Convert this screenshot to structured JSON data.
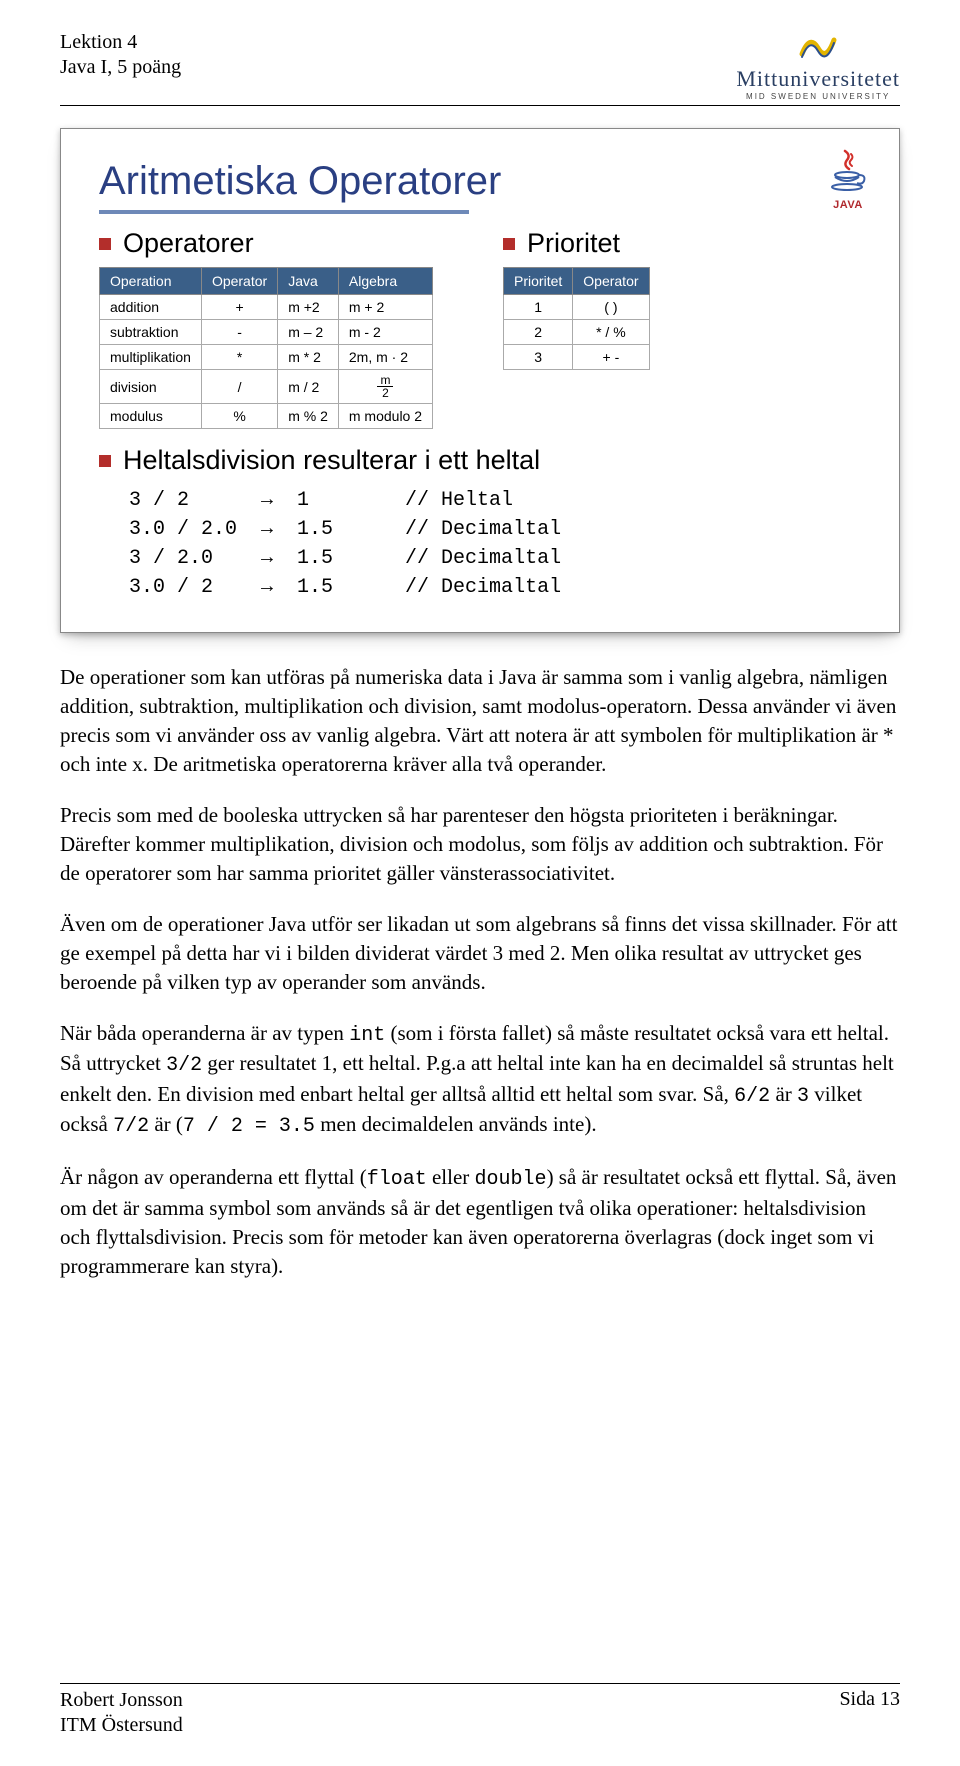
{
  "header": {
    "line1": "Lektion 4",
    "line2": "Java I, 5 poäng",
    "uni_name": "Mittuniversitetet",
    "uni_sub": "MID SWEDEN UNIVERSITY"
  },
  "slide": {
    "java_label": "JAVA",
    "title": "Aritmetiska Operatorer",
    "col1_heading": "Operatorer",
    "col2_heading": "Prioritet",
    "ops_headers": [
      "Operation",
      "Operator",
      "Java",
      "Algebra"
    ],
    "ops_rows": [
      [
        "addition",
        "+",
        "m +2",
        "m + 2"
      ],
      [
        "subtraktion",
        "-",
        "m – 2",
        "m - 2"
      ],
      [
        "multiplikation",
        "*",
        "m * 2",
        "2m, m · 2"
      ],
      [
        "division",
        "/",
        "m / 2",
        "FRAC"
      ],
      [
        "modulus",
        "%",
        "m % 2",
        "m modulo 2"
      ]
    ],
    "prio_headers": [
      "Prioritet",
      "Operator"
    ],
    "prio_rows": [
      [
        "1",
        "( )"
      ],
      [
        "2",
        "* / %"
      ],
      [
        "3",
        "+ -"
      ]
    ],
    "h3": "Heltalsdivision resulterar i ett heltal",
    "code": "3 / 2      →  1        // Heltal\n3.0 / 2.0  →  1.5      // Decimaltal\n3 / 2.0    →  1.5      // Decimaltal\n3.0 / 2    →  1.5      // Decimaltal"
  },
  "body": {
    "p1": "De operationer som kan utföras på numeriska data i Java är samma som i vanlig algebra, nämligen addition, subtraktion, multiplikation och division, samt modolus-operatorn. Dessa använder vi även precis som vi använder oss av vanlig algebra. Värt att notera är att symbolen för multiplikation är * och inte x. De aritmetiska operatorerna kräver alla två operander.",
    "p2": "Precis som med de booleska uttrycken så har parenteser den högsta prioriteten i beräkningar. Därefter kommer multiplikation, division och modolus, som följs av addition och subtraktion. För de operatorer som har samma prioritet gäller vänsterassociativitet.",
    "p3": "Även om de operationer Java utför ser likadan ut som algebrans så finns det vissa skillnader. För att ge exempel på detta har vi i bilden dividerat värdet 3 med 2. Men olika resultat av uttrycket ges beroende på vilken typ av operander som används.",
    "p4a": "När båda operanderna är av typen ",
    "p4_code1": "int",
    "p4b": " (som i första fallet) så måste resultatet också vara ett heltal. Så uttrycket ",
    "p4_code2": "3/2",
    "p4c": " ger resultatet 1, ett heltal. P.g.a att heltal inte kan ha en decimaldel så struntas helt enkelt den. En division med enbart heltal ger alltså alltid ett heltal som svar. Så, ",
    "p4_code3": "6/2",
    "p4d": " är ",
    "p4_code4": "3",
    "p4e": " vilket också ",
    "p4_code5": "7/2",
    "p4f": " är (",
    "p4_code6": "7 / 2 = 3.5",
    "p4g": " men decimaldelen används inte).",
    "p5a": "Är någon av operanderna ett flyttal (",
    "p5_code1": "float",
    "p5b": " eller ",
    "p5_code2": "double",
    "p5c": ") så är resultatet också ett flyttal. Så, även om det är samma symbol som används så är det egentligen två olika operationer: heltalsdivision och flyttalsdivision. Precis som för metoder kan även operatorerna överlagras (dock inget som vi programmerare kan styra)."
  },
  "footer": {
    "author": "Robert Jonsson",
    "dept": "ITM Östersund",
    "page": "Sida 13"
  }
}
